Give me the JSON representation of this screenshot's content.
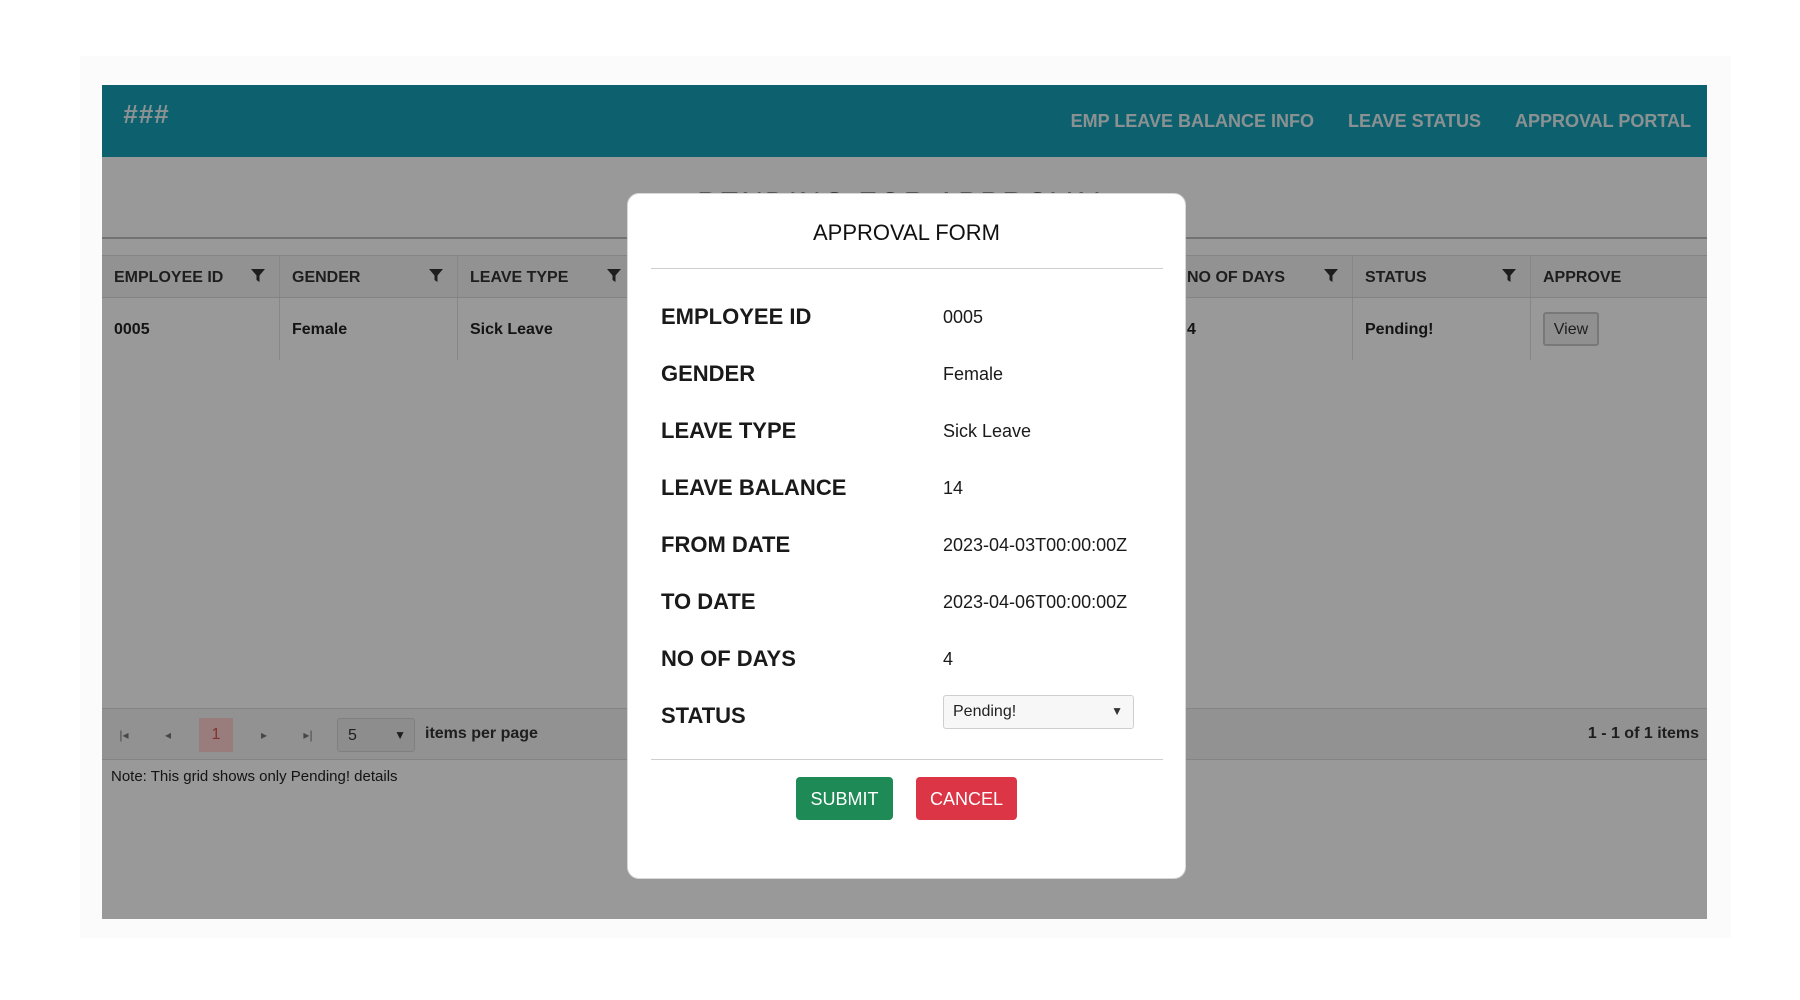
{
  "navbar": {
    "brand": "###",
    "links": [
      "EMP LEAVE BALANCE INFO",
      "LEAVE STATUS",
      "APPROVAL PORTAL"
    ]
  },
  "page_title": "PENDING FOR APPROVAL",
  "grid": {
    "columns": [
      "EMPLOYEE ID",
      "GENDER",
      "LEAVE TYPE",
      "NO OF DAYS",
      "STATUS",
      "APPROVE"
    ],
    "row": {
      "employee_id": "0005",
      "gender": "Female",
      "leave_type": "Sick Leave",
      "no_of_days": "4",
      "status": "Pending!",
      "approve_label": "View"
    },
    "pager": {
      "current_page": "1",
      "page_size": "5",
      "per_page_label": "items per page",
      "range": "1 - 1 of 1 items"
    },
    "note": "Note: This grid shows only Pending! details"
  },
  "modal": {
    "title": "APPROVAL FORM",
    "fields": [
      {
        "label": "EMPLOYEE ID",
        "value": "0005"
      },
      {
        "label": "GENDER",
        "value": "Female"
      },
      {
        "label": "LEAVE TYPE",
        "value": "Sick Leave"
      },
      {
        "label": "LEAVE BALANCE",
        "value": "14"
      },
      {
        "label": "FROM DATE",
        "value": "2023-04-03T00:00:00Z"
      },
      {
        "label": "TO DATE",
        "value": "2023-04-06T00:00:00Z"
      },
      {
        "label": "NO OF DAYS",
        "value": "4"
      }
    ],
    "status": {
      "label": "STATUS",
      "selected": "Pending!"
    },
    "submit_label": "SUBMIT",
    "cancel_label": "CANCEL"
  },
  "colors": {
    "navbar": "#17a2b8",
    "submit": "#1e8a55",
    "cancel": "#dc3545",
    "current_page": "#d9534f"
  }
}
